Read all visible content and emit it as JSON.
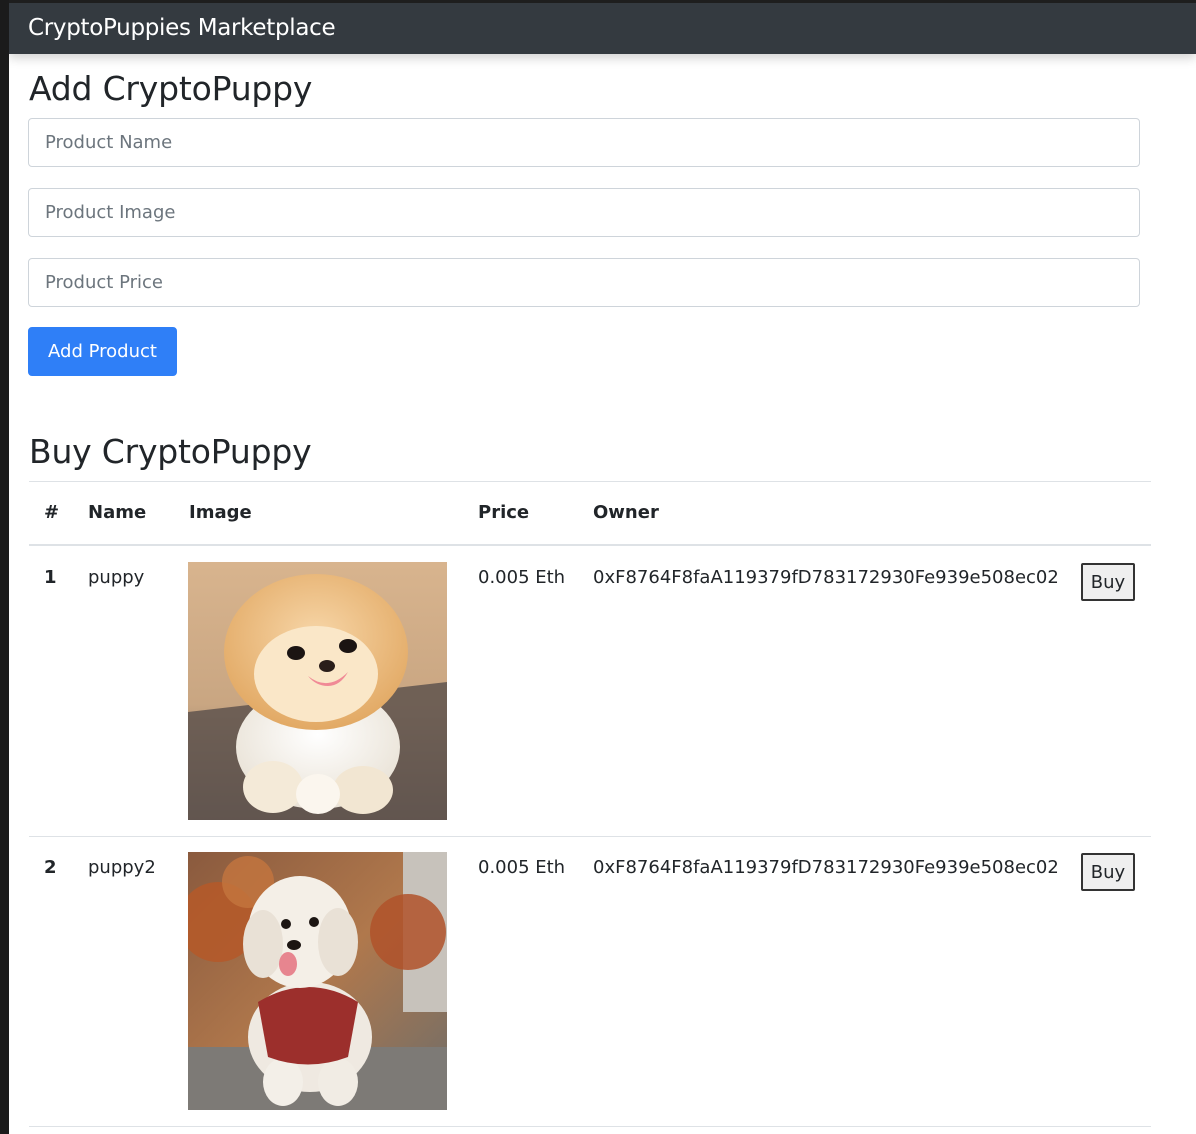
{
  "navbar": {
    "brand": "CryptoPuppies Marketplace"
  },
  "add_section": {
    "title": "Add CryptoPuppy",
    "name_placeholder": "Product Name",
    "image_placeholder": "Product Image",
    "price_placeholder": "Product Price",
    "submit_label": "Add Product"
  },
  "buy_section": {
    "title": "Buy CryptoPuppy",
    "columns": [
      "#",
      "Name",
      "Image",
      "Price",
      "Owner"
    ],
    "rows": [
      {
        "id": "1",
        "name": "puppy",
        "image": "pomeranian-puppy-photo",
        "price": "0.005 Eth",
        "owner": "0xF8764F8faA119379fD783172930Fe939e508ec02",
        "action": "Buy"
      },
      {
        "id": "2",
        "name": "puppy2",
        "image": "white-dog-red-sweater-photo",
        "price": "0.005 Eth",
        "owner": "0xF8764F8faA119379fD783172930Fe939e508ec02",
        "action": "Buy"
      }
    ]
  }
}
